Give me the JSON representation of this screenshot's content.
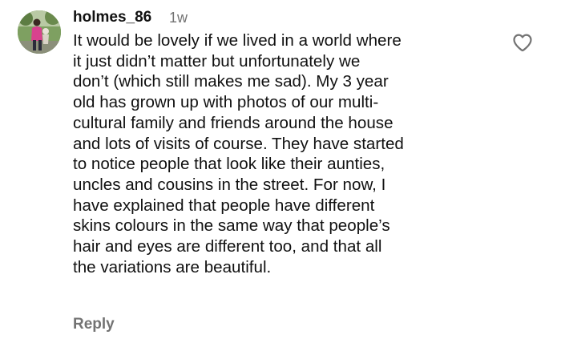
{
  "comment": {
    "username": "holmes_86",
    "timestamp": "1w",
    "body_lines": [
      "It would be lovely if we lived in a world where",
      "it just didn’t matter but unfortunately we",
      "don’t (which still makes me sad). My 3 year",
      "old has grown up with photos of our multi-",
      "cultural family and friends around the house",
      "and lots of visits of course. They have started",
      "to notice people that look like their aunties,",
      "uncles and cousins in the street. For now, I",
      "have explained that people have different",
      "skins colours in the same way that people’s",
      "hair and eyes are different too, and that all",
      "the variations are beautiful."
    ],
    "reply_label": "Reply",
    "like_icon": "heart-outline-icon"
  },
  "colors": {
    "text": "#111111",
    "muted": "#737373",
    "background": "#ffffff"
  }
}
